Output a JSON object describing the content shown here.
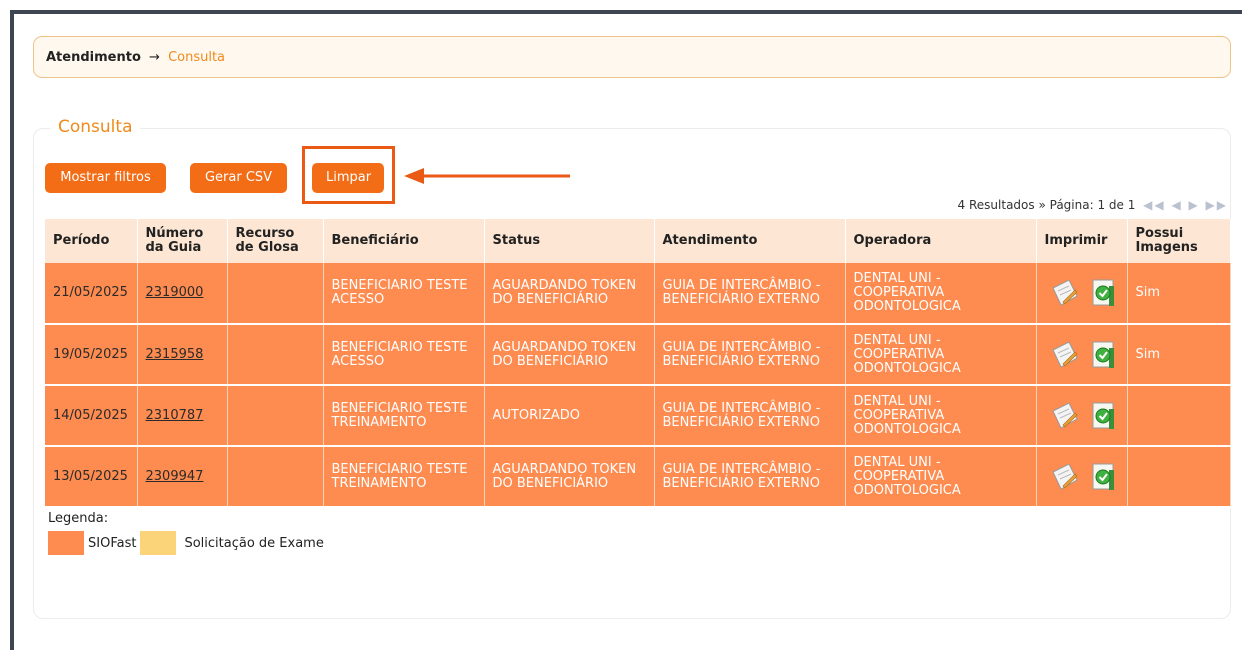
{
  "breadcrumb": {
    "root": "Atendimento",
    "arrow": "→",
    "current": "Consulta"
  },
  "section": {
    "title": "Consulta"
  },
  "buttons": {
    "show_filters": "Mostrar filtros",
    "export_csv": "Gerar CSV",
    "clear": "Limpar"
  },
  "pager": {
    "results": "4 Resultados »",
    "page": "Página: 1 de 1",
    "nav": "◀◀ ◀ ▶ ▶▶"
  },
  "table": {
    "headers": {
      "periodo": "Período",
      "numero_line1": "Número",
      "numero_line2": "da Guia",
      "recurso_line1": "Recurso",
      "recurso_line2": "de Glosa",
      "beneficiario": "Beneficiário",
      "status": "Status",
      "atendimento": "Atendimento",
      "operadora": "Operadora",
      "imprimir": "Imprimir",
      "imagens_line1": "Possui",
      "imagens_line2": "Imagens"
    },
    "rows": [
      {
        "periodo": "21/05/2025",
        "guia": "2319000",
        "recurso": "",
        "beneficiario": "BENEFICIARIO TESTE ACESSO",
        "status": "AGUARDANDO TOKEN DO BENEFICIÁRIO",
        "atendimento": "GUIA DE INTERCÂMBIO - BENEFICIÁRIO EXTERNO",
        "operadora": "DENTAL UNI - COOPERATIVA ODONTOLOGICA",
        "imagens": "Sim"
      },
      {
        "periodo": "19/05/2025",
        "guia": "2315958",
        "recurso": "",
        "beneficiario": "BENEFICIARIO TESTE ACESSO",
        "status": "AGUARDANDO TOKEN DO BENEFICIÁRIO",
        "atendimento": "GUIA DE INTERCÂMBIO - BENEFICIÁRIO EXTERNO",
        "operadora": "DENTAL UNI - COOPERATIVA ODONTOLOGICA",
        "imagens": "Sim"
      },
      {
        "periodo": "14/05/2025",
        "guia": "2310787",
        "recurso": "",
        "beneficiario": "BENEFICIARIO TESTE TREINAMENTO",
        "status": "AUTORIZADO",
        "atendimento": "GUIA DE INTERCÂMBIO - BENEFICIÁRIO EXTERNO",
        "operadora": "DENTAL UNI - COOPERATIVA ODONTOLOGICA",
        "imagens": ""
      },
      {
        "periodo": "13/05/2025",
        "guia": "2309947",
        "recurso": "",
        "beneficiario": "BENEFICIARIO TESTE TREINAMENTO",
        "status": "AGUARDANDO TOKEN DO BENEFICIÁRIO",
        "atendimento": "GUIA DE INTERCÂMBIO - BENEFICIÁRIO EXTERNO",
        "operadora": "DENTAL UNI - COOPERATIVA ODONTOLOGICA",
        "imagens": ""
      }
    ],
    "icons": [
      "edit-document-icon",
      "check-document-icon"
    ]
  },
  "legend": {
    "title": "Legenda:",
    "items": [
      {
        "label": "SIOFast",
        "color": "#fe8b4f"
      },
      {
        "label": "Solicitação de Exame",
        "color": "#fbd47a"
      }
    ]
  },
  "colors": {
    "accent": "#f36c16",
    "row": "#fe8b4f",
    "header": "#fde7d4",
    "annotation": "#ea5a14"
  }
}
